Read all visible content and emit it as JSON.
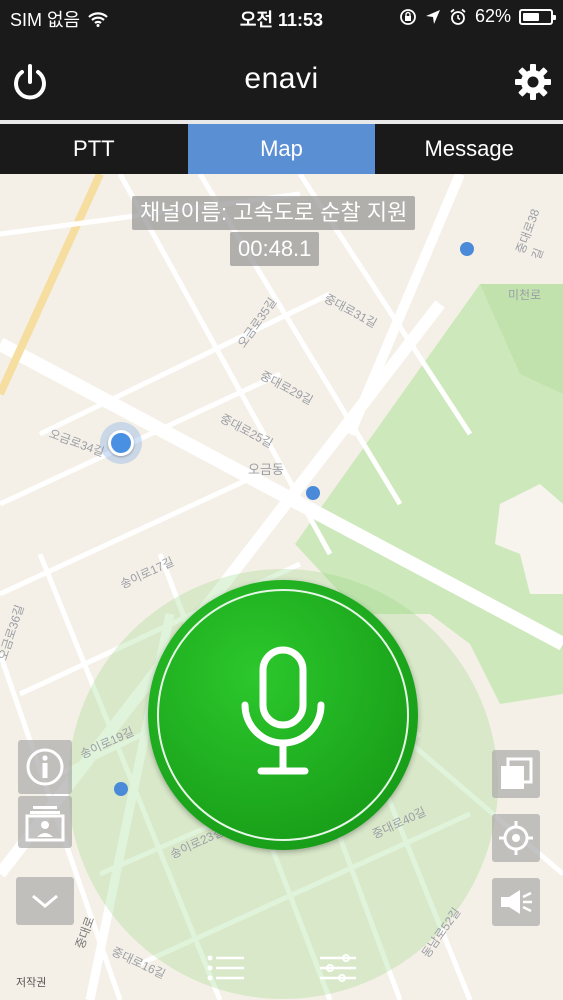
{
  "status_bar": {
    "carrier": "SIM 없음",
    "time": "오전 11:53",
    "battery_percent": "62%",
    "battery_level": 0.62
  },
  "header": {
    "title": "enavi",
    "power_icon": "power-icon",
    "settings_icon": "gear-icon"
  },
  "tabs": [
    {
      "label": "PTT",
      "active": false
    },
    {
      "label": "Map",
      "active": true
    },
    {
      "label": "Message",
      "active": false
    }
  ],
  "map": {
    "channel_name": "채널이름: 고속도로 순찰 지원",
    "timer": "00:48.1",
    "place_labels": [
      "중대로38길",
      "미천로",
      "중대로31길",
      "오금로35길",
      "중대로29길",
      "중대로25길",
      "오금동",
      "오금로34길",
      "송이로17길",
      "송이로19길",
      "오금로36길",
      "송이로23길",
      "중대로40길",
      "중대로16길",
      "동남로52길",
      "저작권",
      "중대로"
    ],
    "accent_color": "#5b8fd4",
    "mic_color": "#1aa81a"
  },
  "controls": {
    "info_icon": "info-icon",
    "contacts_icon": "contacts-icon",
    "collapse_icon": "chevron-down-icon",
    "layers_icon": "layers-icon",
    "locate_icon": "crosshair-icon",
    "speaker_icon": "megaphone-icon",
    "list_icon": "list-icon",
    "filter_icon": "filter-lines-icon",
    "mic_icon": "microphone-icon"
  }
}
